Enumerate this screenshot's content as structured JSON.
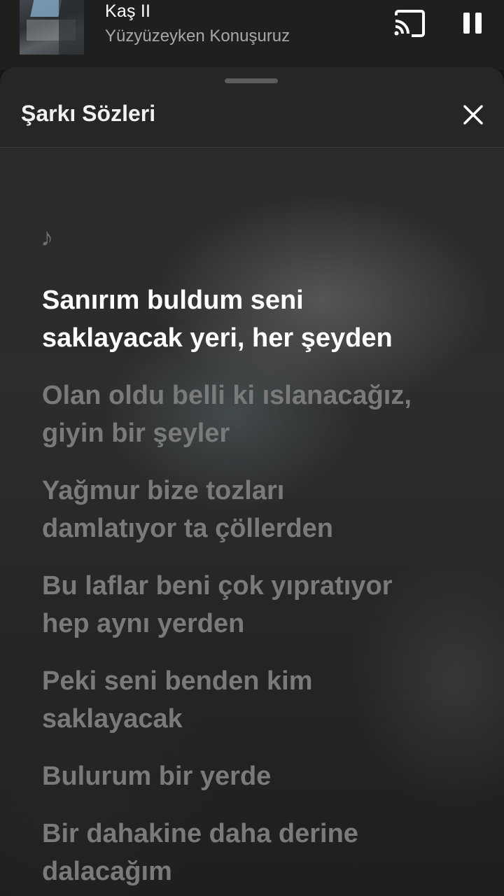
{
  "now_playing": {
    "title": "Kaş II",
    "artist": "Yüzyüzeyken Konuşuruz"
  },
  "controls": {
    "cast_icon": "cast-icon",
    "pause_icon": "pause-icon"
  },
  "lyrics_sheet": {
    "title": "Şarkı Sözleri",
    "close_icon": "close-icon",
    "note_symbol": "♪",
    "lines": [
      {
        "text": "Sanırım buldum seni\nsaklayacak yeri, her şeyden",
        "active": true
      },
      {
        "text": "Olan oldu belli ki ıslanacağız,\ngiyin bir şeyler",
        "active": false
      },
      {
        "text": "Yağmur bize tozları\ndamlatıyor ta çöllerden",
        "active": false
      },
      {
        "text": "Bu laflar beni çok yıpratıyor\nhep aynı yerden",
        "active": false
      },
      {
        "text": "Peki seni benden kim\nsaklayacak",
        "active": false
      },
      {
        "text": "Bulurum bir yerde",
        "active": false
      },
      {
        "text": "Bir dahakine daha derine\ndalacağım",
        "active": false
      }
    ]
  },
  "colors": {
    "active_lyric": "#ffffff",
    "inactive_lyric": "#7a7a7a",
    "sheet_background": "#262626"
  }
}
